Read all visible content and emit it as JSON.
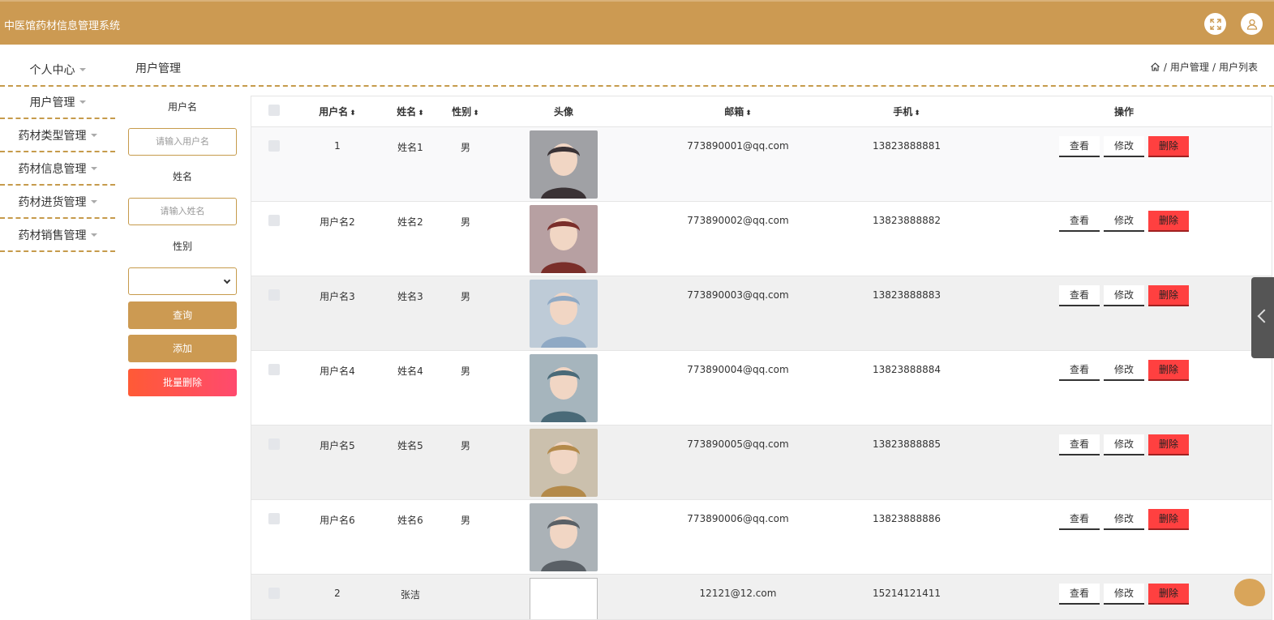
{
  "app": {
    "title": "中医馆药材信息管理系统"
  },
  "header_icons": {
    "fullscreen": "fullscreen-icon",
    "user": "user-icon"
  },
  "sidebar": {
    "items": [
      {
        "label": "个人中心"
      },
      {
        "label": "用户管理"
      },
      {
        "label": "药材类型管理"
      },
      {
        "label": "药材信息管理"
      },
      {
        "label": "药材进货管理"
      },
      {
        "label": "药材销售管理"
      }
    ]
  },
  "page": {
    "title": "用户管理",
    "breadcrumb": [
      "用户管理",
      "用户列表"
    ]
  },
  "search": {
    "username_label": "用户名",
    "username_placeholder": "请输入用户名",
    "name_label": "姓名",
    "name_placeholder": "请输入姓名",
    "gender_label": "性别",
    "gender_value": "",
    "query_button": "查询",
    "add_button": "添加",
    "batch_delete_button": "批量删除"
  },
  "table": {
    "columns": [
      "用户名",
      "姓名",
      "性别",
      "头像",
      "邮箱",
      "手机",
      "操作"
    ],
    "actions": {
      "view": "查看",
      "edit": "修改",
      "delete": "删除"
    },
    "rows": [
      {
        "username": "1",
        "name": "姓名1",
        "gender": "男",
        "email": "773890001@qq.com",
        "phone": "13823888881",
        "avatar_color": "#3a3235"
      },
      {
        "username": "用户名2",
        "name": "姓名2",
        "gender": "男",
        "email": "773890002@qq.com",
        "phone": "13823888882",
        "avatar_color": "#7a2e2a"
      },
      {
        "username": "用户名3",
        "name": "姓名3",
        "gender": "男",
        "email": "773890003@qq.com",
        "phone": "13823888883",
        "avatar_color": "#8fa9c4"
      },
      {
        "username": "用户名4",
        "name": "姓名4",
        "gender": "男",
        "email": "773890004@qq.com",
        "phone": "13823888884",
        "avatar_color": "#4a6a78"
      },
      {
        "username": "用户名5",
        "name": "姓名5",
        "gender": "男",
        "email": "773890005@qq.com",
        "phone": "13823888885",
        "avatar_color": "#b48a4a"
      },
      {
        "username": "用户名6",
        "name": "姓名6",
        "gender": "男",
        "email": "773890006@qq.com",
        "phone": "13823888886",
        "avatar_color": "#5a6066"
      },
      {
        "username": "2",
        "name": "张洁",
        "gender": "",
        "email": "12121@12.com",
        "phone": "15214121411",
        "avatar_color": ""
      }
    ]
  },
  "colors": {
    "brand": "#cc9a52",
    "danger": "#ff4040"
  }
}
